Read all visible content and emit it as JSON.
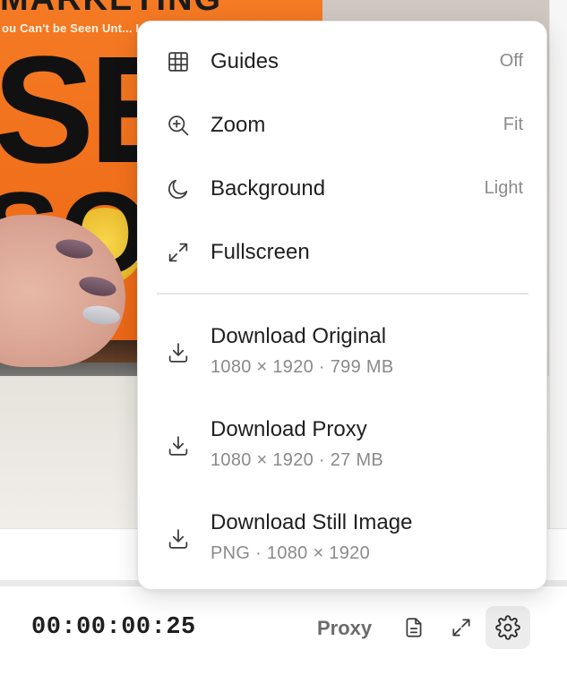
{
  "video": {
    "book_tagline": "ou Can't be Seen Unt... Learn to See",
    "book_headline_top": "MARKETING",
    "book_big_letters": "SE",
    "book_big_letters_2": "SO"
  },
  "menu": {
    "view_items": [
      {
        "label": "Guides",
        "value": "Off",
        "icon": "grid-icon"
      },
      {
        "label": "Zoom",
        "value": "Fit",
        "icon": "zoom-in-icon"
      },
      {
        "label": "Background",
        "value": "Light",
        "icon": "moon-icon"
      },
      {
        "label": "Fullscreen",
        "value": "",
        "icon": "expand-icon"
      }
    ],
    "downloads": [
      {
        "label": "Download Original",
        "detail": "1080 × 1920 · 799 MB",
        "icon": "download-icon"
      },
      {
        "label": "Download Proxy",
        "detail": "1080 × 1920 · 27 MB",
        "icon": "download-icon"
      },
      {
        "label": "Download Still Image",
        "detail": "PNG · 1080 × 1920",
        "icon": "download-icon"
      }
    ]
  },
  "bottom_bar": {
    "timecode": "00:00:00:25",
    "quality_label": "Proxy"
  },
  "colors": {
    "menu_bg": "#ffffff",
    "text_primary": "#1f1f1f",
    "text_secondary": "#8a8a8a",
    "book_orange": "#f57a24",
    "settings_active_bg": "#ececec"
  }
}
